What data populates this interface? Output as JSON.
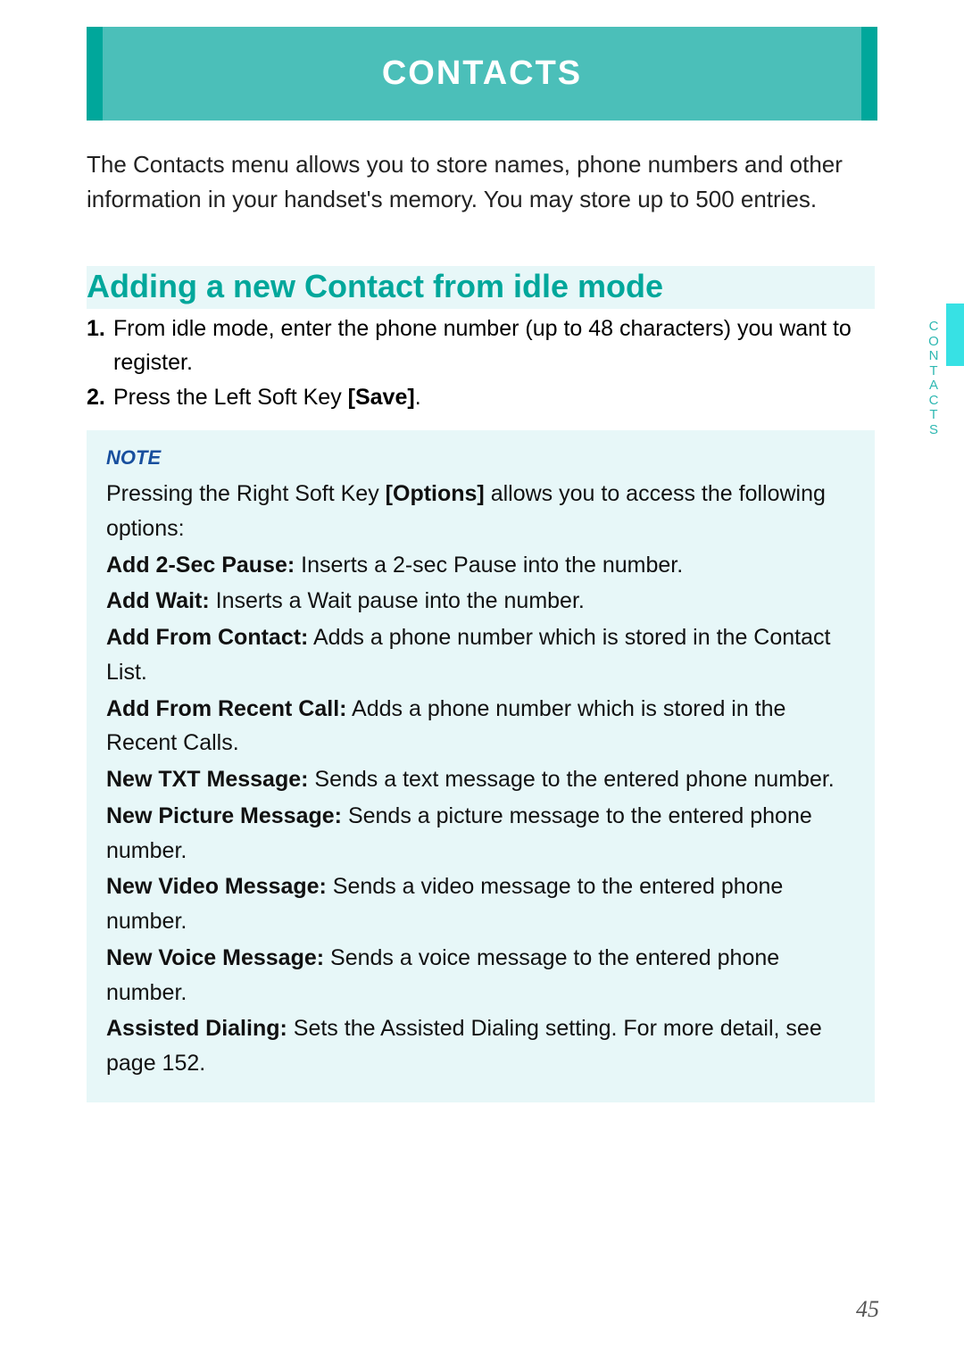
{
  "header": {
    "title": "CONTACTS"
  },
  "intro": "The Contacts menu allows you to store names, phone numbers and other information in your handset's memory. You may store up to 500 entries.",
  "section_heading": "Adding a new Contact from idle mode",
  "steps": [
    {
      "num": "1.",
      "text": "From idle mode, enter the phone number (up to 48 characters) you want to register."
    },
    {
      "num": "2.",
      "prefix": "Press the Left Soft Key ",
      "bold": "[Save]",
      "suffix": "."
    }
  ],
  "note": {
    "label": "NOTE",
    "lead_prefix": "Pressing the Right Soft Key ",
    "lead_bold": "[Options]",
    "lead_suffix": " allows you to access the following options:",
    "options": [
      {
        "name": "Add 2-Sec Pause:",
        "desc": " Inserts a 2-sec Pause into the number."
      },
      {
        "name": "Add Wait:",
        "desc": " Inserts a Wait pause into the number."
      },
      {
        "name": "Add From Contact:",
        "desc": " Adds a phone number which is stored in the Contact List."
      },
      {
        "name": "Add From Recent Call:",
        "desc": " Adds a phone number which is stored in the Recent Calls."
      },
      {
        "name": "New TXT Message:",
        "desc": " Sends a text message to the entered phone number."
      },
      {
        "name": "New Picture Message:",
        "desc": " Sends a picture message to the entered phone number."
      },
      {
        "name": "New Video Message:",
        "desc": " Sends a video message to the entered phone number."
      },
      {
        "name": "New Voice Message:",
        "desc": " Sends a voice message to the entered phone number."
      },
      {
        "name": "Assisted Dialing:",
        "desc": " Sets the Assisted Dialing setting. For more detail, see page 152."
      }
    ]
  },
  "side_label": "CONTACTS",
  "page_number": "45"
}
